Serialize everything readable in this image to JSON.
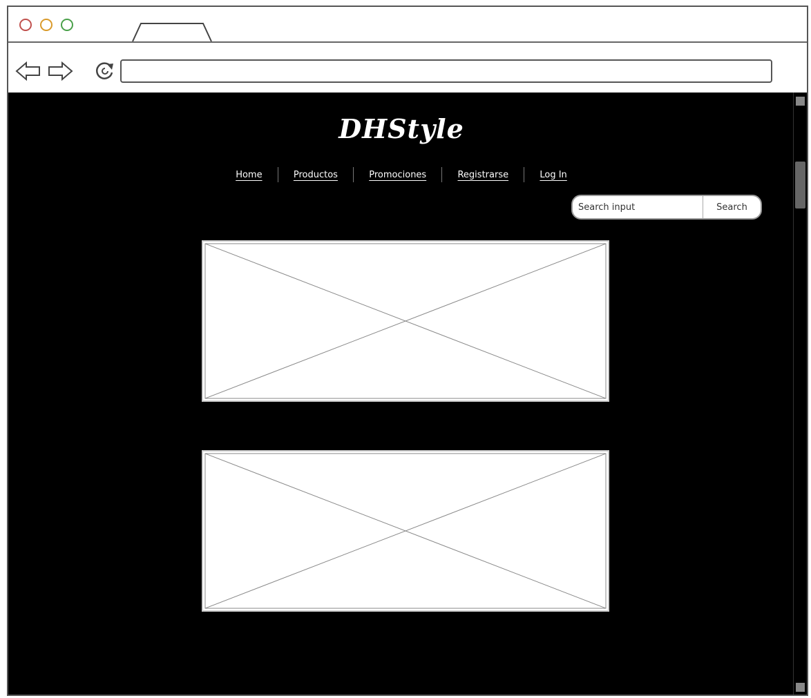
{
  "browser": {
    "url": ""
  },
  "site": {
    "logo": "DHStyle"
  },
  "menu": {
    "items": [
      {
        "label": "Home"
      },
      {
        "label": "Productos"
      },
      {
        "label": "Promociones"
      },
      {
        "label": "Registrarse"
      },
      {
        "label": "Log In"
      }
    ]
  },
  "search": {
    "placeholder": "Search input",
    "button_label": "Search"
  }
}
